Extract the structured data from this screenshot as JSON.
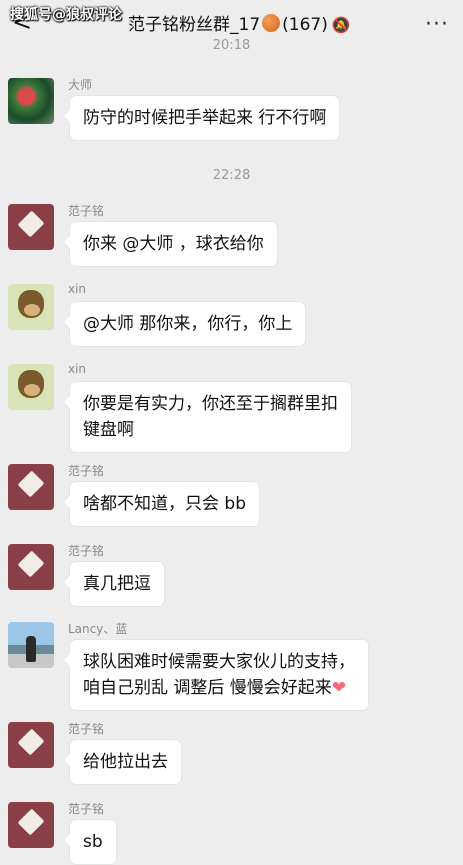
{
  "header": {
    "watermark": "搜狐号@狼叔评论",
    "title": "范子铭粉丝群_17",
    "member_count": "(167)",
    "back_icon": "chevron-left-icon",
    "mute_icon": "bell-mute-icon",
    "more_icon": "more-icon"
  },
  "timestamps": {
    "top_partial": "20:18",
    "middle": "22:28"
  },
  "messages": [
    {
      "sender": "大师",
      "text": "防守的时候把手举起来 行不行啊"
    },
    {
      "sender": "范子铭",
      "text": "你来 @大师 ，球衣给你"
    },
    {
      "sender": "xin",
      "text": "@大师 那你来，你行，你上"
    },
    {
      "sender": "xin",
      "text_line1": "你要是有实力，你还至于搁群里扣",
      "text_line2": "键盘啊"
    },
    {
      "sender": "范子铭",
      "text": "啥都不知道，只会 bb"
    },
    {
      "sender": "范子铭",
      "text": "真几把逗"
    },
    {
      "sender": "Lancy、蓝",
      "text_line1": "球队困难时候需要大家伙儿的支持，",
      "text_line2": "咱自己别乱 调整后 慢慢会好起来",
      "emoji": "❤"
    },
    {
      "sender": "范子铭",
      "text": "给他拉出去"
    },
    {
      "sender": "范子铭",
      "text": "sb"
    }
  ]
}
